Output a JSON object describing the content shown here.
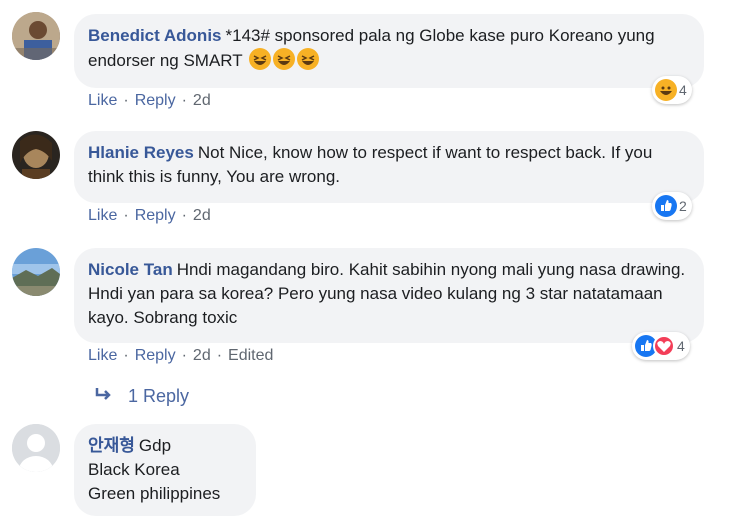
{
  "comments": [
    {
      "author": "Benedict Adonis",
      "text": "*143# sponsored pala ng Globe kase puro Koreano yung endorser ng SMART",
      "emojis": [
        "grinning-squinting-face",
        "grinning-squinting-face",
        "grinning-squinting-face"
      ],
      "actions": {
        "like": "Like",
        "reply": "Reply",
        "time": "2d"
      },
      "reactions": {
        "icons": [
          "haha"
        ],
        "count": "4"
      }
    },
    {
      "author": "Hlanie Reyes",
      "text": "Not Nice, know how to respect if want to respect back. If you think this is funny, You are wrong.",
      "actions": {
        "like": "Like",
        "reply": "Reply",
        "time": "2d"
      },
      "reactions": {
        "icons": [
          "like"
        ],
        "count": "2"
      }
    },
    {
      "author": "Nicole Tan",
      "text": "Hndi magandang biro. Kahit sabihin nyong mali yung nasa drawing. Hndi yan para sa korea? Pero yung nasa video kulang ng 3 star natatamaan kayo. Sobrang toxic",
      "actions": {
        "like": "Like",
        "reply": "Reply",
        "time": "2d",
        "edited": "Edited"
      },
      "reactions": {
        "icons": [
          "like",
          "love"
        ],
        "count": "4"
      }
    },
    {
      "author": "안재형",
      "text_lines": [
        "Gdp",
        "Black Korea",
        "Green philippines"
      ]
    }
  ],
  "replies_link": "1 Reply",
  "colors": {
    "bubble": "#f2f3f5",
    "author": "#385898",
    "link": "#4b67a1",
    "meta": "#606770",
    "like": "#1877f2",
    "love": "#f33e58",
    "haha": "#f7b125"
  }
}
